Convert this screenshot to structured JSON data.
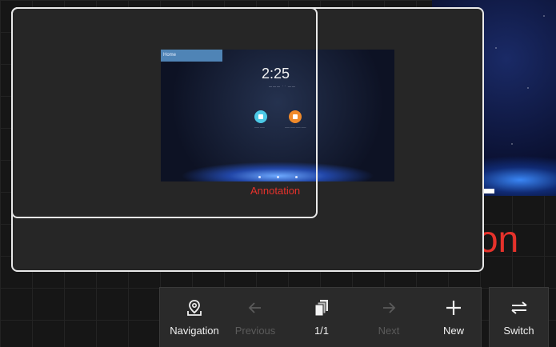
{
  "background": {
    "partial_text": "on"
  },
  "navigator": {
    "thumbnail": {
      "tab_label": "Home",
      "clock": "2:25",
      "date": "——— ·· ——",
      "app_labels": [
        "—— ——",
        "—— —— —— ——"
      ],
      "annotation_label": "Annotation"
    }
  },
  "toolbar": {
    "navigation_label": "Navigation",
    "previous_label": "Previous",
    "page_indicator": "1/1",
    "next_label": "Next",
    "new_label": "New",
    "switch_label": "Switch"
  },
  "colors": {
    "accent_red": "#e6322b",
    "panel_border": "#e9e9e9",
    "toolbar_bg": "#2a2a2a",
    "disabled_text": "#5b5b5b"
  }
}
